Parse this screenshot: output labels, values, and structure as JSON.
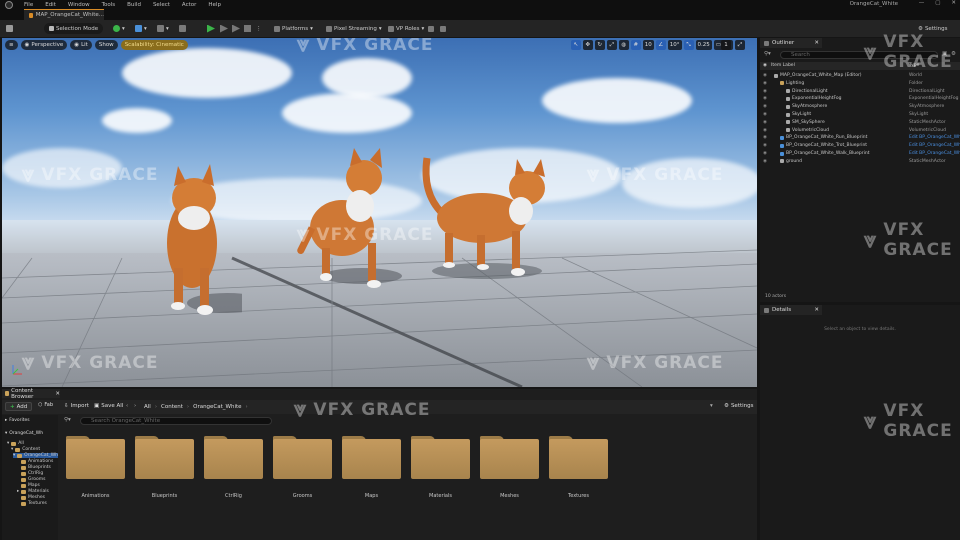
{
  "menubar": {
    "items": [
      "File",
      "Edit",
      "Window",
      "Tools",
      "Build",
      "Select",
      "Actor",
      "Help"
    ],
    "project_title": "OrangeCat_White"
  },
  "tabs": {
    "level_tab": "MAP_OrangeCat_White..."
  },
  "toolbar": {
    "selection_mode": "Selection Mode",
    "platforms": "Platforms",
    "pixel_streaming": "Pixel Streaming",
    "vp_roles": "VP Roles",
    "settings": "Settings"
  },
  "viewport": {
    "perspective": "Perspective",
    "lit": "Lit",
    "show": "Show",
    "scalability": "Scalability: Cinematic",
    "grid_snap": "10",
    "rot_snap": "10°",
    "scale_snap": "0.25",
    "camera_speed": "1"
  },
  "watermark": "VFX GRACE",
  "content_browser": {
    "tab_label": "Content Browser",
    "add": "Add",
    "import": "Import",
    "save_all": "Save All",
    "breadcrumbs": [
      "All",
      "Content",
      "OrangeCat_White"
    ],
    "settings": "Settings",
    "search_placeholder": "Search OrangeCat_White",
    "favorites": "Favorites",
    "tree": {
      "root": "OrangeCat_Wh",
      "all": "All",
      "content": "Content",
      "selected": "OrangeCat_Wh",
      "children": [
        "Animations",
        "Blueprints",
        "CtrlRig",
        "Grooms",
        "Maps",
        "Materials",
        "Meshes",
        "Textures"
      ]
    },
    "folders": [
      "Animations",
      "Blueprints",
      "CtrlRig",
      "Grooms",
      "Maps",
      "Materials",
      "Meshes",
      "Textures"
    ]
  },
  "outliner": {
    "tab_label": "Outliner",
    "search_placeholder": "Search",
    "col_label": "Item Label",
    "col_type": "Type",
    "rows": [
      {
        "label": "MAP_OrangeCat_White_Map (Editor)",
        "type": "World",
        "indent": 0,
        "link": false
      },
      {
        "label": "Lighting",
        "type": "Folder",
        "indent": 1,
        "link": false
      },
      {
        "label": "DirectionalLight",
        "type": "DirectionalLight",
        "indent": 2,
        "link": false
      },
      {
        "label": "ExponentialHeightFog",
        "type": "ExponentialHeightFog",
        "indent": 2,
        "link": false
      },
      {
        "label": "SkyAtmosphere",
        "type": "SkyAtmosphere",
        "indent": 2,
        "link": false
      },
      {
        "label": "SkyLight",
        "type": "SkyLight",
        "indent": 2,
        "link": false
      },
      {
        "label": "SM_SkySphere",
        "type": "StaticMeshActor",
        "indent": 2,
        "link": false
      },
      {
        "label": "VolumetricCloud",
        "type": "VolumetricCloud",
        "indent": 2,
        "link": false
      },
      {
        "label": "BP_OrangeCat_White_Run_Blueprint",
        "type": "Edit BP_OrangeCat_Wh",
        "indent": 1,
        "link": true
      },
      {
        "label": "BP_OrangeCat_White_Trot_Blueprint",
        "type": "Edit BP_OrangeCat_Wh",
        "indent": 1,
        "link": true
      },
      {
        "label": "BP_OrangeCat_White_Walk_Blueprint",
        "type": "Edit BP_OrangeCat_Wh",
        "indent": 1,
        "link": true
      },
      {
        "label": "ground",
        "type": "StaticMeshActor",
        "indent": 1,
        "link": false
      }
    ],
    "footer": "10 actors"
  },
  "details": {
    "tab_label": "Details",
    "empty_message": "Select an object to view details."
  },
  "colors": {
    "accent_orange": "#d98c27",
    "play_green": "#3bb54a",
    "link_blue": "#4a8fe0",
    "folder_tan": "#c49a5e"
  }
}
